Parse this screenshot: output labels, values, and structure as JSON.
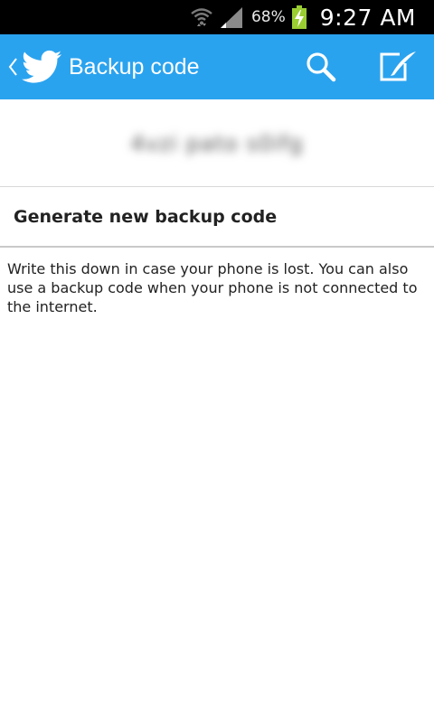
{
  "status_bar": {
    "battery_percent": "68%",
    "time": "9:27 AM",
    "icons": [
      "wifi-icon",
      "signal-icon",
      "battery-charging-icon"
    ]
  },
  "action_bar": {
    "title": "Backup code",
    "icons": [
      "back-chevron-icon",
      "twitter-bird-icon",
      "search-icon",
      "compose-icon"
    ],
    "color": "#2aa3ef"
  },
  "backup_code": {
    "code": "4vzi pato s0ifg"
  },
  "generate_button": {
    "label": "Generate new backup code"
  },
  "help": {
    "text": "Write this down in case your phone is lost. You can also use a backup code when your phone is not connected to the internet."
  }
}
